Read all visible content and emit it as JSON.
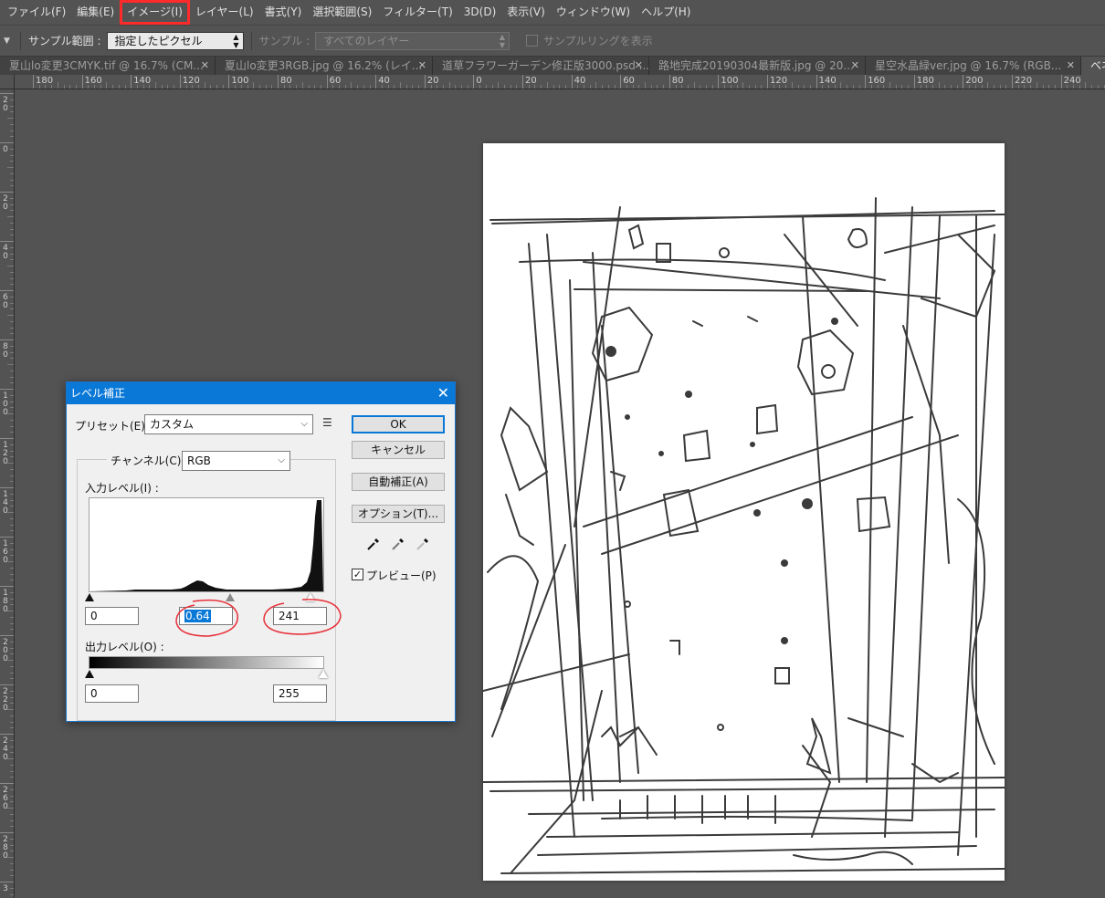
{
  "menubar": {
    "items": [
      "ファイル(F)",
      "編集(E)",
      "イメージ(I)",
      "レイヤー(L)",
      "書式(Y)",
      "選択範囲(S)",
      "フィルター(T)",
      "3D(D)",
      "表示(V)",
      "ウィンドウ(W)",
      "ヘルプ(H)"
    ],
    "highlighted_index": 2,
    "highlight_color": "#ff2a2a"
  },
  "options_bar": {
    "sample_range_label": "サンプル範囲 :",
    "sample_range_value": "指定したピクセル",
    "sample_label": "サンプル :",
    "sample_value": "すべてのレイヤー",
    "show_ring_label": "サンプルリングを表示"
  },
  "tabs": [
    {
      "label": "夏山lo変更3CMYK.tif @ 16.7% (CM...",
      "active": false
    },
    {
      "label": "夏山lo変更3RGB.jpg @ 16.2% (レイ...",
      "active": false
    },
    {
      "label": "道草フラワーガーデン修正版3000.psd ...",
      "active": false
    },
    {
      "label": "路地完成20190304最新版.jpg @ 20...",
      "active": false
    },
    {
      "label": "星空水晶緑ver.jpg @ 16.7% (RGB...",
      "active": false
    },
    {
      "label": "ベネツ",
      "active": true
    }
  ],
  "ruler_h_labels": [
    "180",
    "160",
    "140",
    "120",
    "100",
    "80",
    "60",
    "40",
    "20",
    "0",
    "20",
    "40",
    "60",
    "80",
    "100",
    "120",
    "140",
    "160",
    "180",
    "200",
    "220",
    "240"
  ],
  "ruler_v_labels": [
    [
      "2",
      "0"
    ],
    [
      "0"
    ],
    [
      "2",
      "0"
    ],
    [
      "4",
      "0"
    ],
    [
      "6",
      "0"
    ],
    [
      "8",
      "0"
    ],
    [
      "1",
      "0",
      "0"
    ],
    [
      "1",
      "2",
      "0"
    ],
    [
      "1",
      "4",
      "0"
    ],
    [
      "1",
      "6",
      "0"
    ],
    [
      "1",
      "8",
      "0"
    ],
    [
      "2",
      "0",
      "0"
    ],
    [
      "2",
      "2",
      "0"
    ],
    [
      "2",
      "4",
      "0"
    ],
    [
      "2",
      "6",
      "0"
    ],
    [
      "2",
      "8",
      "0"
    ],
    [
      "3"
    ]
  ],
  "dialog": {
    "title": "レベル補正",
    "preset_label": "プリセット(E) :",
    "preset_value": "カスタム",
    "channel_label": "チャンネル(C) :",
    "channel_value": "RGB",
    "input_levels_label": "入力レベル(I) :",
    "input_black": "0",
    "input_gamma": "0.64",
    "input_white": "241",
    "output_levels_label": "出力レベル(O) :",
    "output_black": "0",
    "output_white": "255",
    "ok_label": "OK",
    "cancel_label": "キャンセル",
    "auto_label": "自動補正(A)",
    "options_label": "オプション(T)...",
    "preview_label": "プレビュー(P)",
    "preview_checked": true,
    "annotation_color": "#e8303a"
  }
}
